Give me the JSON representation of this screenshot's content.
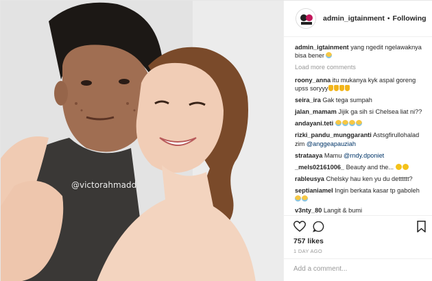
{
  "watermark": "@victorahmadd",
  "header": {
    "username": "admin_igtainment",
    "separator": "•",
    "follow_label": "Following"
  },
  "caption": {
    "username": "admin_igtainment",
    "text": "yang ngedit ngelawaknya bisa bener"
  },
  "load_more": "Load more comments",
  "comments": [
    {
      "username": "roony_anna",
      "text": "itu mukanya kyk aspal goreng upss soryyy",
      "mention": "",
      "emoji_after": [
        "ok",
        "ok",
        "ok",
        "ok"
      ]
    },
    {
      "username": "seira_ira",
      "text": "Gak tega sumpah",
      "mention": "",
      "emoji_after": []
    },
    {
      "username": "jalan_mamam",
      "text": "Jijik ga sih si Chelsea liat ni??",
      "mention": "",
      "emoji_after": []
    },
    {
      "username": "andayani.teti",
      "text": "",
      "mention": "",
      "emoji_after": [
        "tear",
        "tear",
        "tear",
        "tear"
      ]
    },
    {
      "username": "rizki_pandu_munggaranti",
      "text": "Astsgfirullohalad zim",
      "mention": "@anggeapauziah",
      "emoji_after": []
    },
    {
      "username": "strataaya",
      "text": "Mamu",
      "mention": "@rndy.dponiet",
      "emoji_after": []
    },
    {
      "username": "_mels02161006_",
      "text": "Beauty and the...",
      "mention": "",
      "emoji_after": [
        "neutral",
        "neutral"
      ]
    },
    {
      "username": "rableusya",
      "text": "Chelsky hau ken yu du detttttt?",
      "mention": "",
      "emoji_after": []
    },
    {
      "username": "septianiamel",
      "text": "Ingin berkata kasar tp gaboleh",
      "mention": "",
      "emoji_after": [
        "tear",
        "tear"
      ]
    },
    {
      "username": "v3nty_80",
      "text": "Langit & bumi",
      "mention": "",
      "emoji_after": []
    }
  ],
  "likes": "757 likes",
  "time": "1 DAY AGO",
  "add_comment_placeholder": "Add a comment...",
  "colors": {
    "link": "#003569",
    "muted": "#999999",
    "border": "#efefef"
  }
}
